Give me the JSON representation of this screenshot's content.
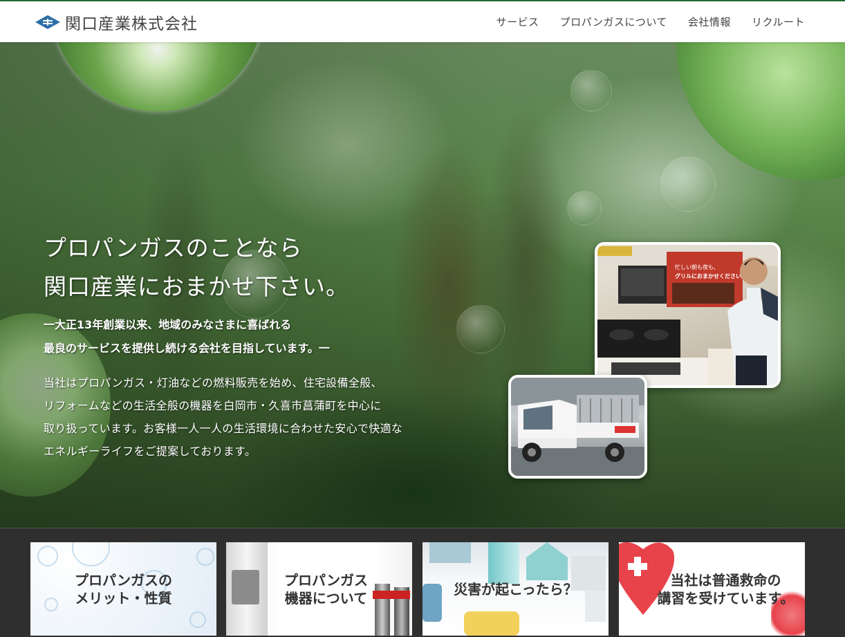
{
  "header": {
    "logo_text": "関口産業株式会社",
    "nav": [
      "サービス",
      "プロパンガスについて",
      "会社情報",
      "リクルート"
    ]
  },
  "hero": {
    "title_line1": "プロパンガスのことなら",
    "title_line2": "関口産業におまかせ下さい。",
    "sub_line1": "一大正13年創業以来、地域のみなさまに喜ばれる",
    "sub_line2": "最良のサービスを提供し続ける会社を目指しています。一",
    "body_line1": "当社はプロパンガス・灯油などの燃料販売を始め、住宅設備全般、",
    "body_line2": "リフォームなどの生活全般の機器を白岡市・久喜市菖蒲町を中心に",
    "body_line3": "取り扱っています。お客様一人一人の生活環境に合わせた安心で快適な",
    "body_line4": "エネルギーライフをご提案しております。",
    "store_sign_1": "忙しい朝も夜も、",
    "store_sign_2": "グリルにおまかせください。"
  },
  "cards": [
    {
      "line1": "プロパンガスの",
      "line2": "メリット・性質"
    },
    {
      "line1": "プロパンガス",
      "line2": "機器について"
    },
    {
      "line1": "災害が起こったら？",
      "line2": ""
    },
    {
      "line1": "当社は普通救命の",
      "line2": "講習を受けています。"
    }
  ],
  "colors": {
    "header_bg": "#ffffff",
    "header_border": "#1f6b2f",
    "nav_text": "#444444",
    "bottom_bg": "#2f2f2f",
    "heart": "#e8424a",
    "logo_blue": "#2c6fa8"
  },
  "icons": {
    "logo_mark": "diamond-logo-icon"
  }
}
